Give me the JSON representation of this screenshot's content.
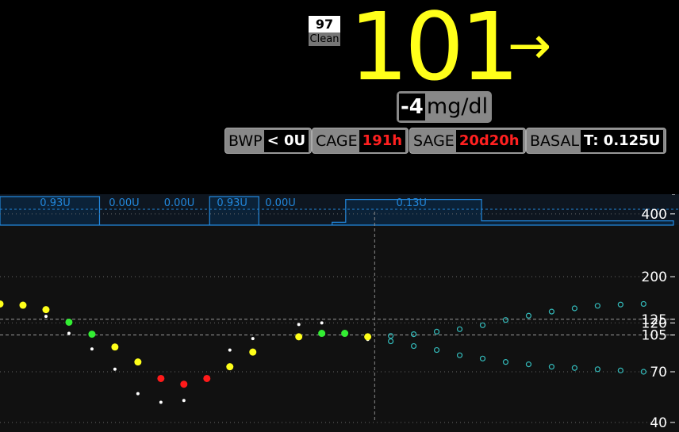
{
  "header": {
    "raw": {
      "value": "97",
      "label": "Clean"
    },
    "bg": {
      "value": "101",
      "arrow": "→",
      "color": "#ffff1a"
    },
    "delta": {
      "value": "-4",
      "units": "mg/dl"
    },
    "pills": [
      {
        "label": "BWP",
        "value": "< 0U",
        "value_color": "#ffffff"
      },
      {
        "label": "CAGE",
        "value": "191h",
        "value_color": "#ff2020"
      },
      {
        "label": "SAGE",
        "value": "20d20h",
        "value_color": "#ff2020"
      },
      {
        "label": "BASAL",
        "value": "T: 0.125U",
        "value_color": "#ffffff"
      }
    ]
  },
  "chart_data": {
    "type": "scatter",
    "y_scale": "log",
    "ylim": [
      36,
      480
    ],
    "xlim": [
      0,
      29.3
    ],
    "y_ticks": [
      "400",
      "200",
      "125",
      "120",
      "105",
      "70",
      "40"
    ],
    "y_tick_values": [
      400,
      200,
      125,
      120,
      105,
      70,
      40
    ],
    "now_x": 16.3,
    "colors": {
      "inRange": "#33ee33",
      "high": "#ffff1a",
      "low": "#ff1a1a",
      "mbg": "#ffffff",
      "forecast": "#33bbbb",
      "basal": "#2288dd"
    },
    "readings": [
      {
        "x": 0,
        "y": 148,
        "color": "yellow"
      },
      {
        "x": 1,
        "y": 146,
        "color": "yellow"
      },
      {
        "x": 2,
        "y": 139,
        "color": "yellow"
      },
      {
        "x": 3,
        "y": 121,
        "color": "green"
      },
      {
        "x": 4,
        "y": 106,
        "color": "green"
      },
      {
        "x": 5,
        "y": 92,
        "color": "yellow"
      },
      {
        "x": 6,
        "y": 78,
        "color": "yellow"
      },
      {
        "x": 7,
        "y": 65,
        "color": "red"
      },
      {
        "x": 8,
        "y": 61,
        "color": "red"
      },
      {
        "x": 9,
        "y": 65,
        "color": "red"
      },
      {
        "x": 10,
        "y": 74,
        "color": "yellow"
      },
      {
        "x": 11,
        "y": 87,
        "color": "yellow"
      },
      {
        "x": 13,
        "y": 103,
        "color": "yellow"
      },
      {
        "x": 14,
        "y": 107,
        "color": "green"
      },
      {
        "x": 15,
        "y": 107,
        "color": "green"
      },
      {
        "x": 16,
        "y": 103,
        "color": "yellow"
      }
    ],
    "mbg": [
      {
        "x": 2,
        "y": 129
      },
      {
        "x": 3,
        "y": 107
      },
      {
        "x": 4,
        "y": 90
      },
      {
        "x": 5,
        "y": 72
      },
      {
        "x": 6,
        "y": 55
      },
      {
        "x": 7,
        "y": 50
      },
      {
        "x": 8,
        "y": 51
      },
      {
        "x": 9,
        "y": 64
      },
      {
        "x": 10,
        "y": 89
      },
      {
        "x": 11,
        "y": 101
      },
      {
        "x": 13,
        "y": 118
      },
      {
        "x": 14,
        "y": 120
      },
      {
        "x": 16,
        "y": 100
      }
    ],
    "forecast": [
      {
        "x": 17,
        "y": 104
      },
      {
        "x": 18,
        "y": 106
      },
      {
        "x": 19,
        "y": 109
      },
      {
        "x": 20,
        "y": 112
      },
      {
        "x": 21,
        "y": 117
      },
      {
        "x": 22,
        "y": 124
      },
      {
        "x": 23,
        "y": 130
      },
      {
        "x": 24,
        "y": 136
      },
      {
        "x": 25,
        "y": 141
      },
      {
        "x": 26,
        "y": 145
      },
      {
        "x": 27,
        "y": 147
      },
      {
        "x": 28,
        "y": 148
      },
      {
        "x": 17,
        "y": 98
      },
      {
        "x": 18,
        "y": 93
      },
      {
        "x": 19,
        "y": 89
      },
      {
        "x": 20,
        "y": 84
      },
      {
        "x": 21,
        "y": 81
      },
      {
        "x": 22,
        "y": 78
      },
      {
        "x": 23,
        "y": 76
      },
      {
        "x": 24,
        "y": 74
      },
      {
        "x": 25,
        "y": 73
      },
      {
        "x": 26,
        "y": 72
      },
      {
        "x": 27,
        "y": 71
      },
      {
        "x": 28,
        "y": 70
      }
    ],
    "basal": {
      "max": 0.2,
      "profile": 0.1,
      "segments": [
        {
          "x0": 0,
          "x1": 4.33,
          "rate": 0.2,
          "label": "0.93U"
        },
        {
          "x0": 4.33,
          "x1": 9.12,
          "rate": 0,
          "label": "0.00U"
        },
        {
          "x0": 4.33,
          "x1": 9.12,
          "rate": 0,
          "label": "0.00U"
        },
        {
          "x0": 9.12,
          "x1": 11.26,
          "rate": 0.2,
          "label": "0.93U"
        },
        {
          "x0": 11.26,
          "x1": 14.45,
          "rate": 0,
          "label": "0.00U"
        },
        {
          "x0": 14.45,
          "x1": 15.04,
          "rate": 0.02,
          "label": ""
        },
        {
          "x0": 15.04,
          "x1": 20.95,
          "rate": 0.18,
          "label": "0.13U"
        },
        {
          "x0": 20.95,
          "x1": 29.3,
          "rate": 0.03,
          "label": ""
        }
      ],
      "label_positions": [
        2.4,
        5.4,
        7.8,
        10.1,
        12.2,
        17.9
      ]
    }
  }
}
